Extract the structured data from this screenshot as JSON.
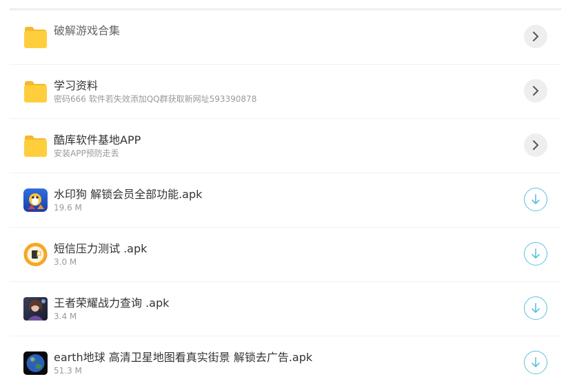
{
  "items": [
    {
      "type": "folder",
      "title": "破解游戏合集",
      "subtitle": "",
      "icon": "folder-icon",
      "action_icon": "chevron-right-icon"
    },
    {
      "type": "folder",
      "title": "学习资料",
      "subtitle": "密码666 软件若失效添加QQ群获取新网址593390878",
      "icon": "folder-icon",
      "action_icon": "chevron-right-icon"
    },
    {
      "type": "folder",
      "title": "酷库软件基地APP",
      "subtitle": "安装APP预防走丢",
      "icon": "folder-icon",
      "action_icon": "chevron-right-icon"
    },
    {
      "type": "file",
      "title": "水印狗 解锁会员全部功能.apk",
      "subtitle": "19.6 M",
      "icon": "watermark-dog-app-icon",
      "action_icon": "download-icon"
    },
    {
      "type": "file",
      "title": "短信压力测试 .apk",
      "subtitle": "3.0 M",
      "icon": "sms-app-icon",
      "action_icon": "download-icon"
    },
    {
      "type": "file",
      "title": "王者荣耀战力查询 .apk",
      "subtitle": "3.4 M",
      "icon": "game-character-app-icon",
      "action_icon": "download-icon"
    },
    {
      "type": "file",
      "title": "earth地球 高清卫星地图看真实街景 解锁去广告.apk",
      "subtitle": "51.3 M",
      "icon": "earth-globe-app-icon",
      "action_icon": "download-icon"
    }
  ],
  "colors": {
    "folder": "#FFCE3D",
    "download_accent": "#5BC0DE",
    "nav_button_bg": "#EEEEEE"
  }
}
